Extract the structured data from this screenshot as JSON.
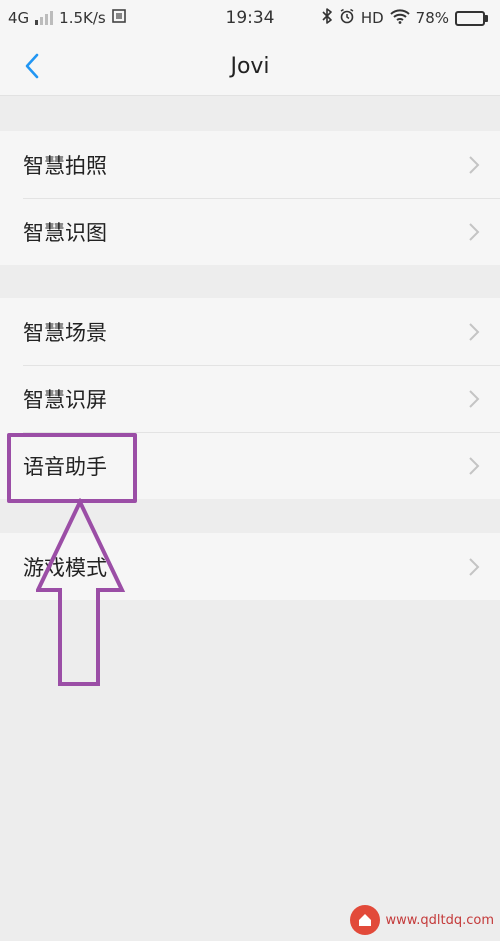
{
  "status_bar": {
    "network": "4G",
    "speed": "1.5K/s",
    "time": "19:34",
    "hd": "HD",
    "battery": "78%",
    "battery_level": 0.78,
    "icons": [
      "signal-icon",
      "data-saver-icon",
      "bluetooth-icon",
      "alarm-icon",
      "wifi-icon",
      "battery-icon"
    ]
  },
  "nav": {
    "title": "Jovi",
    "back_icon": "chevron-left-icon"
  },
  "groups": [
    {
      "items": [
        {
          "label": "智慧拍照"
        },
        {
          "label": "智慧识图"
        }
      ]
    },
    {
      "items": [
        {
          "label": "智慧场景"
        },
        {
          "label": "智慧识屏"
        },
        {
          "label": "语音助手"
        }
      ]
    },
    {
      "items": [
        {
          "label": "游戏模式"
        }
      ]
    }
  ],
  "annotation": {
    "color": "#9b4ea6",
    "highlighted_item": "语音助手"
  },
  "watermark": {
    "site": "www.qdltdq.com"
  },
  "colors": {
    "accent": "#1e88e5",
    "background": "#ededed",
    "surface": "#f6f6f6"
  }
}
